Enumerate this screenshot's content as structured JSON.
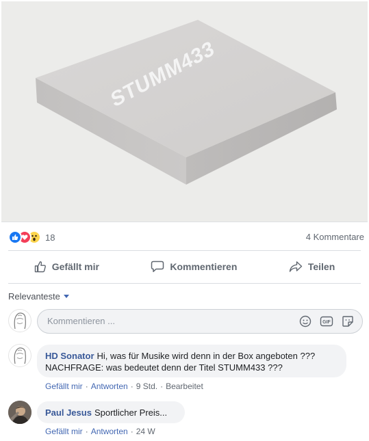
{
  "post": {
    "image_text": "STUMM433",
    "reaction_count": "18",
    "comments_count": "4 Kommentare"
  },
  "actions": {
    "like": "Gefällt mir",
    "comment": "Kommentieren",
    "share": "Teilen"
  },
  "sort": {
    "label": "Relevanteste"
  },
  "composer": {
    "placeholder": "Kommentieren ...",
    "tools": [
      "emoji-icon",
      "gif-icon",
      "sticker-icon"
    ]
  },
  "comments": [
    {
      "author": "HD Sonator",
      "text": "Hi, was für Musike wird denn in der Box angeboten ??? NACHFRAGE: was bedeutet denn der Titel STUMM433 ???",
      "like": "Gefällt mir",
      "reply": "Antworten",
      "time": "9 Std.",
      "edited": "Bearbeitet"
    },
    {
      "author": "Paul Jesus",
      "text": "Sportlicher Preis...",
      "like": "Gefällt mir",
      "reply": "Antworten",
      "time": "24 W"
    }
  ],
  "colors": {
    "link": "#385898",
    "like_blue": "#1877f2",
    "love_red": "#f33e58",
    "wow_yellow": "#fcd54d"
  }
}
